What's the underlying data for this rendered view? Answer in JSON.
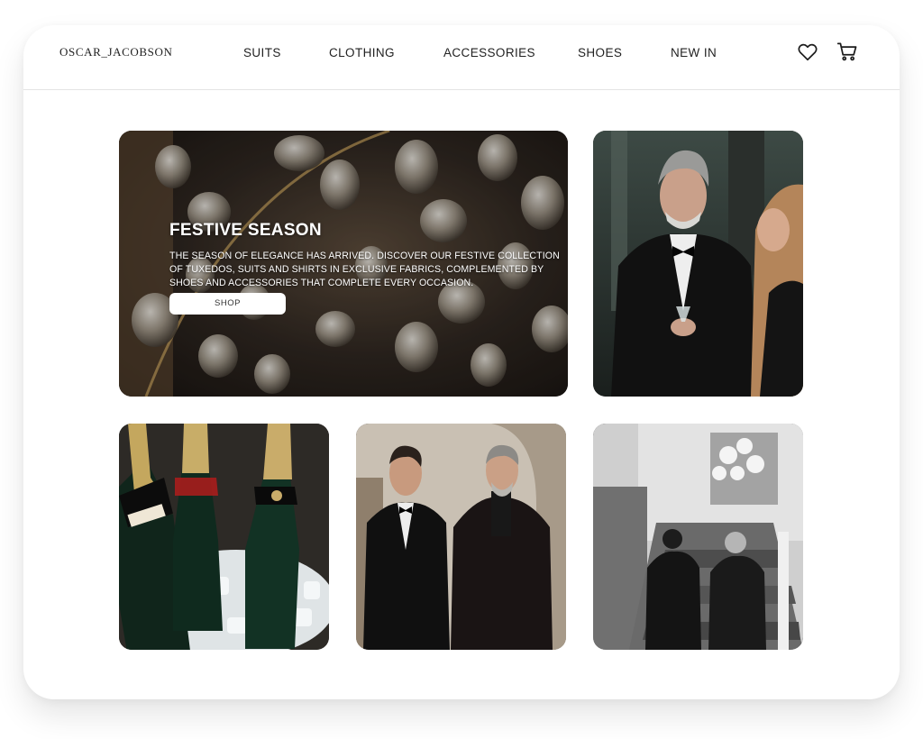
{
  "brand": {
    "logo_text": "OSCAR_JACOBSON"
  },
  "nav": {
    "items": [
      "SUITS",
      "CLOTHING",
      "ACCESSORIES",
      "SHOES",
      "NEW IN"
    ]
  },
  "header_icons": [
    "heart-icon",
    "cart-icon"
  ],
  "hero": {
    "title": "FESTIVE SEASON",
    "body": "THE SEASON OF ELEGANCE HAS ARRIVED. DISCOVER OUR FESTIVE COLLECTION OF TUXEDOS, SUITS AND SHIRTS IN EXCLUSIVE FABRICS, COMPLEMENTED BY SHOES AND ACCESSORIES THAT COMPLETE EVERY OCCASION.",
    "button_label": "SHOP"
  },
  "tiles": [
    {
      "name": "chandelier-crystals-photo"
    },
    {
      "name": "man-in-tuxedo-photo"
    },
    {
      "name": "champagne-bottles-photo"
    },
    {
      "name": "two-men-evening-wear-photo"
    },
    {
      "name": "staircase-black-white-photo"
    }
  ],
  "colors": {
    "text": "#1c1c1c",
    "divider": "#e4e4e4",
    "background": "#ffffff"
  }
}
